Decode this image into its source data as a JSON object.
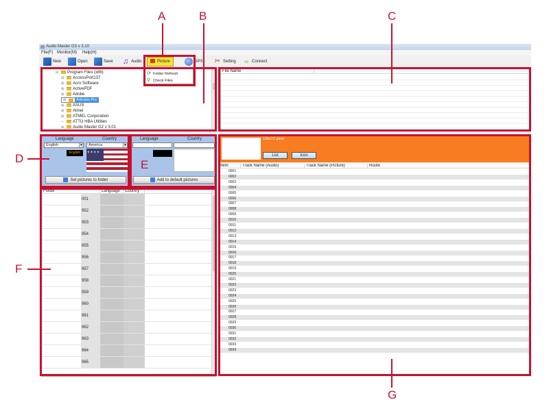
{
  "callouts": [
    "A",
    "B",
    "C",
    "D",
    "E",
    "F",
    "G"
  ],
  "window": {
    "title": "Audio Master G3 v 3.10"
  },
  "menu": [
    "File(F)",
    "Monitor(M)",
    "Help(H)"
  ],
  "toolbar": [
    {
      "label": "New",
      "icon": "new-document-icon"
    },
    {
      "label": "Open",
      "icon": "folder-open-icon"
    },
    {
      "label": "Save",
      "icon": "floppy-save-icon"
    },
    {
      "label": "Audio",
      "icon": "music-note-icon"
    },
    {
      "label": "Picture",
      "icon": "flag-picture-icon",
      "active": true
    },
    {
      "label": "GPS",
      "icon": "globe-icon"
    },
    {
      "label": "Setting",
      "icon": "tools-icon"
    },
    {
      "label": "Connect",
      "icon": "connect-plug-icon"
    }
  ],
  "picture_menu": [
    "Folder Refresh",
    "Check Files"
  ],
  "tree": {
    "items": [
      {
        "label": "Program Files (x86)",
        "level": 0
      },
      {
        "label": "AccessPort137",
        "level": 1
      },
      {
        "label": "Acro Software",
        "level": 1
      },
      {
        "label": "ActivePDF",
        "level": 1
      },
      {
        "label": "Adobe",
        "level": 1
      },
      {
        "label": "Articans Pro",
        "level": 1,
        "selected": true
      },
      {
        "label": "ASUS",
        "level": 1
      },
      {
        "label": "Atmel",
        "level": 1
      },
      {
        "label": "ATMEL Corporation",
        "level": 1
      },
      {
        "label": "ATTO HBA Utilities",
        "level": 1
      },
      {
        "label": "Audio Master G2 v 3.01",
        "level": 1
      }
    ]
  },
  "file_list": {
    "header": "File Name"
  },
  "panel_d": {
    "language_header": "Language",
    "country_header": "Country",
    "language_value": "English",
    "country_value": "America",
    "preview_text": "English",
    "button": "Set pictures to folder"
  },
  "panel_e": {
    "language_header": "Language",
    "country_header": "Country",
    "button": "Add to default pictures"
  },
  "grid_f": {
    "headers": [
      "Folder",
      "Language",
      "Country"
    ],
    "rows": [
      "001",
      "952",
      "953",
      "954",
      "955",
      "956",
      "957",
      "958",
      "959",
      "960",
      "961",
      "962",
      "963",
      "964",
      "965"
    ]
  },
  "grid_g": {
    "size_label": "136x72 pixel",
    "tabs": [
      "List",
      "Icon"
    ],
    "headers": [
      "Item",
      "Track Name (Audio)",
      "Track Name (Picture)",
      "Route"
    ],
    "rows": [
      "0001",
      "0002",
      "0003",
      "0004",
      "0005",
      "0006",
      "0007",
      "0008",
      "0009",
      "0010",
      "0011",
      "0012",
      "0013",
      "0014",
      "0015",
      "0016",
      "0017",
      "0018",
      "0019",
      "0020",
      "0021",
      "0022",
      "0023",
      "0024",
      "0025",
      "0026",
      "0027",
      "0028",
      "0029",
      "0030",
      "0031",
      "0032",
      "0033",
      "0034"
    ]
  },
  "colors": {
    "callout": "#c8102e",
    "panel_blue": "#a9c4e8",
    "orange": "#f77c22",
    "highlight": "#f5e23a"
  }
}
